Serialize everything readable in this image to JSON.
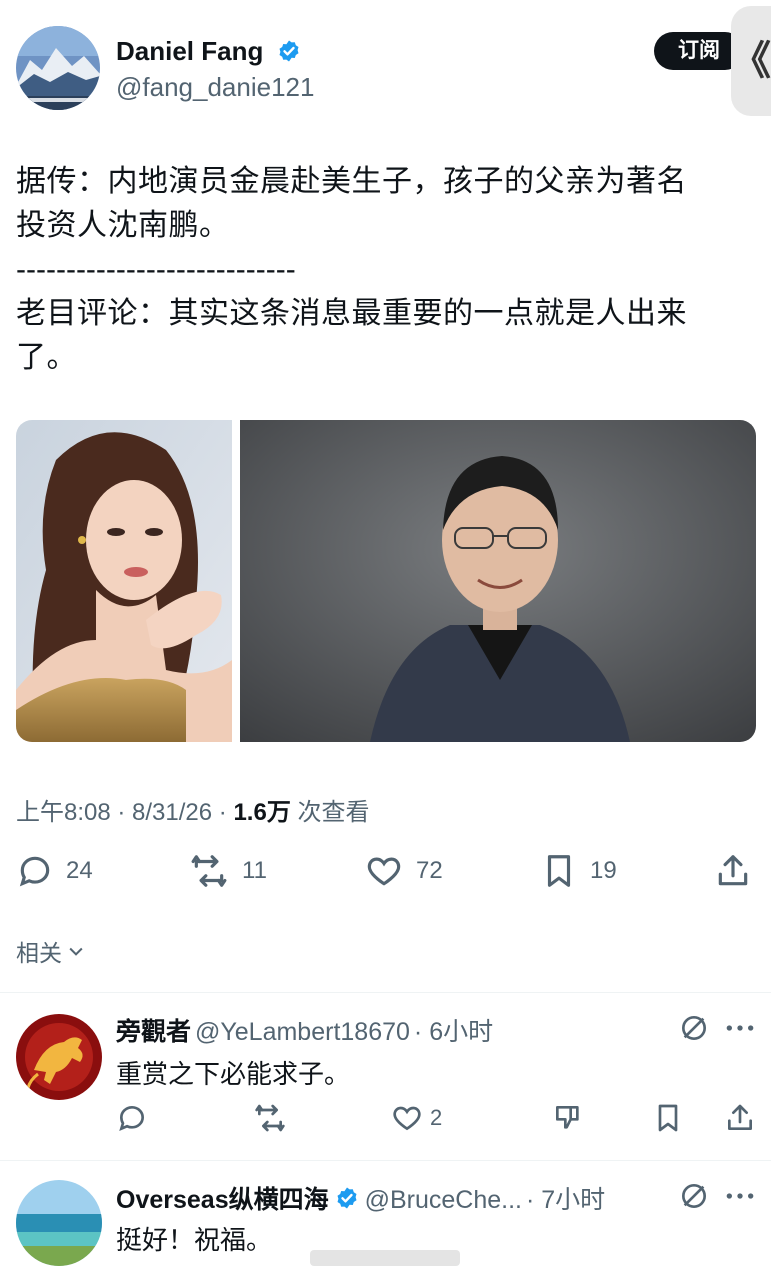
{
  "tweet": {
    "author_name": "Daniel Fang",
    "author_handle": "@fang_danie121",
    "subscribe_label": "订阅",
    "side_tab_glyph": "《",
    "text_line1": "据传：内地演员金晨赴美生子，孩子的父亲为著名",
    "text_line2": "投资人沈南鹏。",
    "separator": "----------------------------",
    "text_line3": "老目评论：其实这条消息最重要的一点就是人出来",
    "text_line4": "了。",
    "time": "上午8:08 · 8/31/26 · ",
    "views_count": "1.6万",
    "views_label": " 次查看",
    "stats": {
      "replies": "24",
      "retweets": "11",
      "likes": "72",
      "bookmarks": "19"
    },
    "related_label": "相关"
  },
  "replies": [
    {
      "name": "旁觀者",
      "handle": "@YeLambert18670",
      "time": "· 6小时",
      "text": "重赏之下必能求子。",
      "likes": "2"
    },
    {
      "name": "Overseas纵横四海",
      "handle": "@BruceChe...",
      "time": "· 7小时",
      "text": "挺好！祝福。"
    }
  ],
  "colors": {
    "verified_blue": "#1d9bf0",
    "muted_text": "#536471",
    "main_text": "#0f1419"
  }
}
